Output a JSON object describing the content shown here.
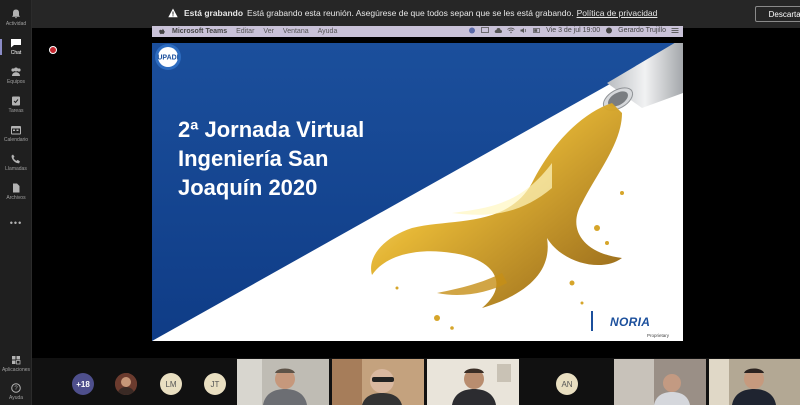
{
  "rail": {
    "items": [
      {
        "label": "Actividad",
        "icon": "bell-icon"
      },
      {
        "label": "Chat",
        "icon": "chat-icon"
      },
      {
        "label": "Equipos",
        "icon": "teams-icon"
      },
      {
        "label": "Tareas",
        "icon": "tasks-icon"
      },
      {
        "label": "Calendario",
        "icon": "calendar-icon"
      },
      {
        "label": "Llamadas",
        "icon": "phone-icon"
      },
      {
        "label": "Archivos",
        "icon": "files-icon"
      },
      {
        "label": "•••",
        "icon": "more-icon"
      }
    ],
    "bottom": [
      {
        "label": "Aplicaciones",
        "icon": "apps-icon"
      },
      {
        "label": "Ayuda",
        "icon": "help-icon"
      }
    ]
  },
  "banner": {
    "title": "Está grabando",
    "message": "Está grabando esta reunión. Asegúrese de que todos sepan que se les está grabando.",
    "link": "Política de privacidad",
    "dismiss": "Descartar"
  },
  "macbar": {
    "app": "Microsoft Teams",
    "menus": [
      "Editar",
      "Ver",
      "Ventana",
      "Ayuda"
    ],
    "date": "Vie 3 de jul  19:00",
    "user": "Gerardo Trujillo"
  },
  "slide": {
    "title_lines": [
      "2ª Jornada Virtual",
      "Ingeniería San",
      "Joaquín 2020"
    ],
    "logo_left": "UPADI",
    "logo_right": "NORIA",
    "logo_right_caption": "Proprietary"
  },
  "participants": {
    "overflow": "+18",
    "initials": [
      "LM",
      "JT",
      "AN"
    ]
  },
  "colors": {
    "slide_blue": "#1d4c9a",
    "accent": "#4e4f8c",
    "record": "#c4262e"
  }
}
